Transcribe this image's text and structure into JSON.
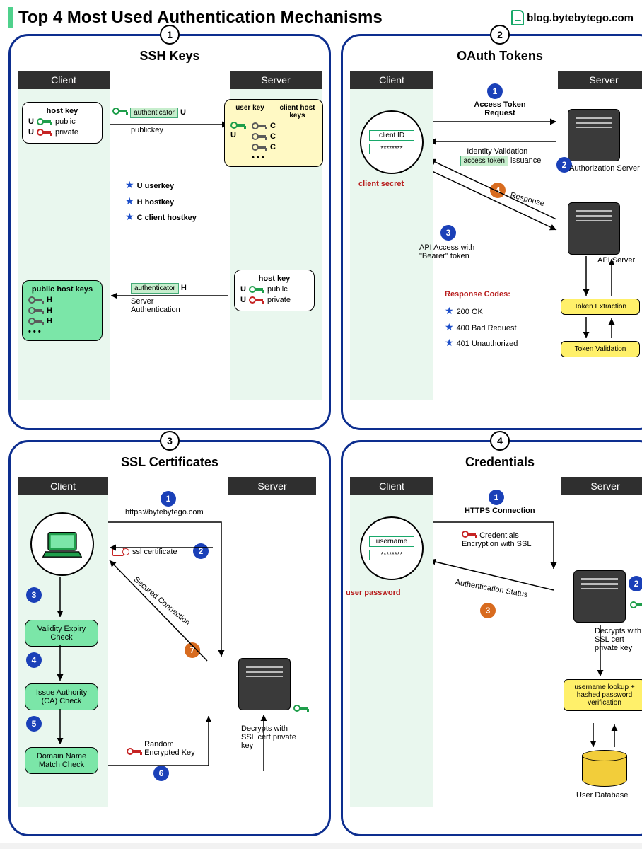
{
  "header": {
    "title": "Top 4 Most Used Authentication Mechanisms",
    "source": "blog.bytebytego.com"
  },
  "panels": [
    {
      "num": "1",
      "title": "SSH Keys",
      "client": "Client",
      "server": "Server"
    },
    {
      "num": "2",
      "title": "OAuth Tokens",
      "client": "Client",
      "server": "Server"
    },
    {
      "num": "3",
      "title": "SSL Certificates",
      "client": "Client",
      "server": "Server"
    },
    {
      "num": "4",
      "title": "Credentials",
      "client": "Client",
      "server": "Server"
    }
  ],
  "ssh": {
    "hostkey_label": "host key",
    "u": "U",
    "public": "public",
    "private": "private",
    "authenticator": "authenticator",
    "publickey": "publickey",
    "userkey_label": "user key",
    "clienthostkeys_label": "client host keys",
    "c": "C",
    "dots": "• • •",
    "legend": {
      "u": "U  userkey",
      "h": "H  hostkey",
      "c": "C  client hostkey"
    },
    "publichostkeys": "public host keys",
    "h": "H",
    "server_auth": "Server Authentication"
  },
  "oauth": {
    "clientid": "client ID",
    "stars": "********",
    "client_secret": "client secret",
    "step1": "Access Token Request",
    "step2_a": "Identity Validation +",
    "step2_b": "access token",
    "step2_c": "issuance",
    "auth_server": "Authorization Server",
    "step3": "API Access with \"Bearer\" token",
    "step4": "Response",
    "api_server": "API Server",
    "token_extraction": "Token Extraction",
    "token_validation": "Token Validation",
    "resp_hdr": "Response Codes:",
    "r200": "200 OK",
    "r400": "400 Bad Request",
    "r401": "401 Unauthorized",
    "n1": "1",
    "n2": "2",
    "n3": "3",
    "n4": "4"
  },
  "ssl": {
    "url": "https://bytebytego.com",
    "ssl_cert": "ssl certificate",
    "validity": "Validity Expiry Check",
    "ca": "Issue Authority (CA) Check",
    "domain": "Domain Name Match Check",
    "secured": "Secured Connection",
    "random_key": "Random Encrypted Key",
    "decrypt": "Decrypts with SSL cert private key",
    "n1": "1",
    "n2": "2",
    "n3": "3",
    "n4": "4",
    "n5": "5",
    "n6": "6",
    "n7": "7"
  },
  "cred": {
    "username": "username",
    "stars": "********",
    "user_password": "user password",
    "https": "HTTPS Connection",
    "enc": "Credentials Encryption with SSL",
    "auth_status": "Authentication Status",
    "decrypt": "Decrypts with SSL cert private key",
    "lookup": "username lookup + hashed password verification",
    "userdb": "User Database",
    "n1": "1",
    "n2": "2",
    "n3": "3"
  }
}
